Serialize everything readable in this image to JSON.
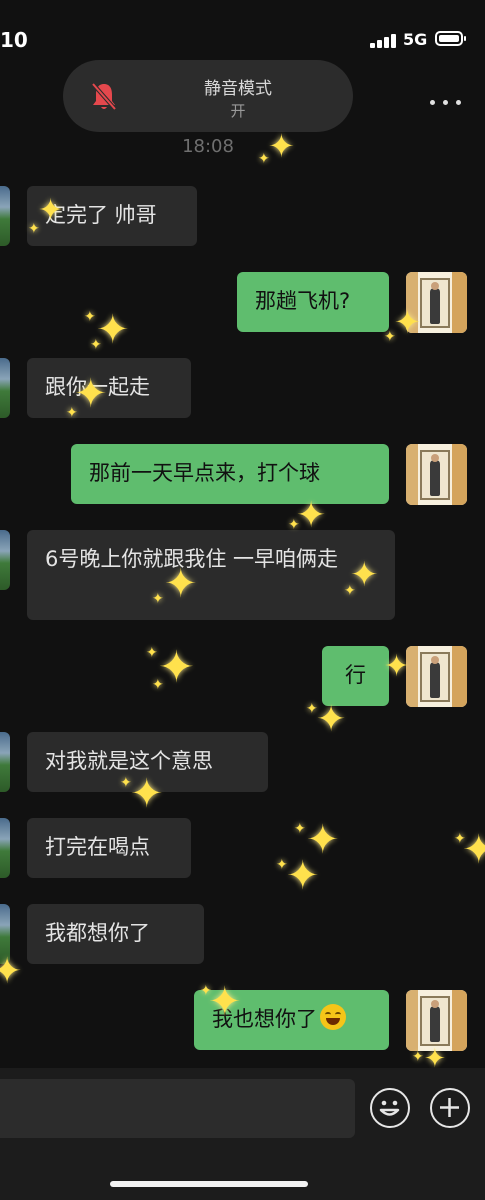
{
  "status_bar": {
    "time": "10",
    "network": "5G"
  },
  "mute_banner": {
    "title": "静音模式",
    "state": "开",
    "icon": "bell-slash-icon"
  },
  "menu": {
    "icon": "more-horizontal-icon"
  },
  "conversation": {
    "timestamp": "18:08",
    "messages": [
      {
        "side": "left",
        "text": "定完了 帅哥"
      },
      {
        "side": "right",
        "text": "那趟飞机?"
      },
      {
        "side": "left",
        "text": "跟你一起走"
      },
      {
        "side": "right",
        "text": "那前一天早点来，打个球"
      },
      {
        "side": "left",
        "text": "6号晚上你就跟我住 一早咱俩走"
      },
      {
        "side": "right",
        "text": "行"
      },
      {
        "side": "left",
        "text": "对我就是这个意思"
      },
      {
        "side": "left",
        "text": "打完在喝点"
      },
      {
        "side": "left",
        "text": "我都想你了"
      },
      {
        "side": "right",
        "text": "我也想你了",
        "emoji": "face-with-tears-of-joy-icon"
      }
    ]
  },
  "input_bar": {
    "emoji_icon": "smiley-icon",
    "add_icon": "plus-circle-icon"
  },
  "colors": {
    "background": "#111111",
    "sent_bubble": "#5fbd6e",
    "received_bubble": "#2b2b2b",
    "sparkle": "#ffe14d"
  }
}
